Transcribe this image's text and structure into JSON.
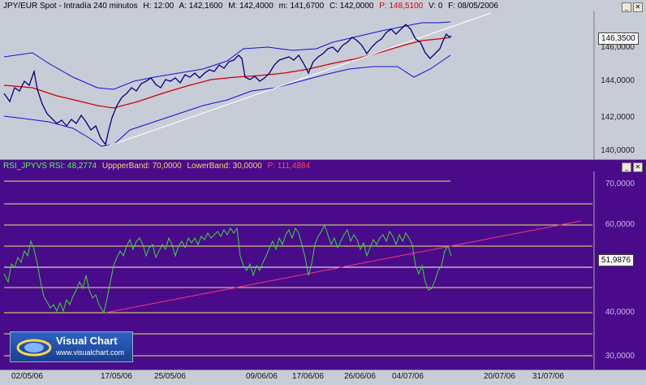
{
  "top_header": {
    "symbol": "JPY/EUR Spot - Intradía 240 minutos",
    "h": "H: 12:00",
    "a": "A: 142,1600",
    "m_high": "M: 142,4000",
    "m_low": "m: 141,6700",
    "c": "C: 142,0000",
    "p": "P: 148,5100",
    "v": "V: 0",
    "f": "F: 08/05/2006"
  },
  "bottom_header": {
    "rsi": "RSI_JPYVS RSI: 48,2774",
    "upper": "UppperBand: 70,0000",
    "lower": "LowerBand: 30,0000",
    "p": "P: 111,4884"
  },
  "top_axis": {
    "labels": [
      "146,0000",
      "144,0000",
      "142,0000",
      "140,0000"
    ],
    "last": "146,3500"
  },
  "bot_axis": {
    "labels": [
      "70,0000",
      "60,0000",
      "40,0000",
      "30,0000"
    ],
    "last": "51,9876"
  },
  "x_axis": [
    "02/05/06",
    "17/05/06",
    "25/05/06",
    "09/06/06",
    "17/06/06",
    "26/06/06",
    "04/07/06",
    "20/07/06",
    "31/07/06"
  ],
  "logo": {
    "title": "Visual Chart",
    "url": "www.visualchart.com"
  },
  "colors": {
    "price": "#000080",
    "bands": "#1010e0",
    "ma": "#cc0000",
    "trend": "#ffffff",
    "rsi": "#33dd33",
    "rsi_trend": "#ff3388",
    "level": "#e8e86a"
  }
}
